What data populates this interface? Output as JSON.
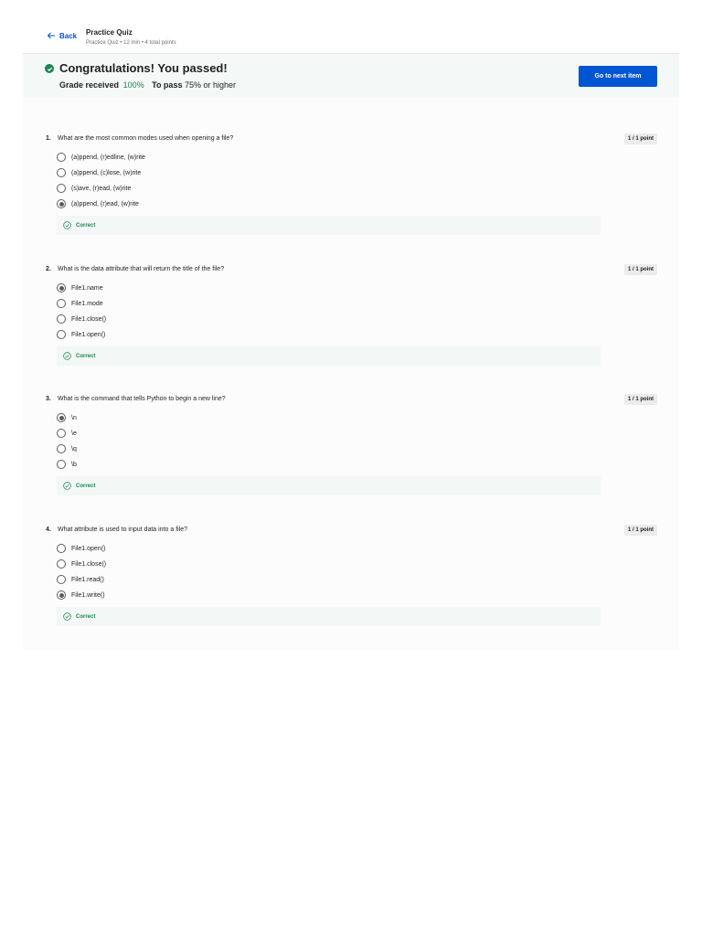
{
  "header": {
    "back_label": "Back",
    "title": "Practice Quiz",
    "subtitle": "Practice Quiz • 12 min • 4 total points"
  },
  "banner": {
    "message": "Congratulations! You passed!",
    "grade_label": "Grade received",
    "grade_value": "100%",
    "pass_label": "To pass",
    "pass_value": "75% or higher",
    "next_button": "Go to next item",
    "colors": {
      "success": "#1f8354",
      "primary": "#0056d2"
    }
  },
  "questions": [
    {
      "number": "1.",
      "text": "What are the most common modes used when opening a file?",
      "points": "1 / 1 point",
      "options": [
        "(a)ppend, (r)edline, (w)rite",
        "(a)ppend, (c)lose, (w)rite",
        "(s)ave, (r)ead, (w)rite",
        "(a)ppend, (r)ead, (w)rite"
      ],
      "selected_index": 3,
      "feedback": "Correct"
    },
    {
      "number": "2.",
      "text": "What is the data attribute that will return the title of the file?",
      "points": "1 / 1 point",
      "options": [
        "File1.name",
        "File1.mode",
        "File1.close()",
        "File1.open()"
      ],
      "selected_index": 0,
      "feedback": "Correct"
    },
    {
      "number": "3.",
      "text": "What is the command that tells Python to begin a new line?",
      "points": "1 / 1 point",
      "options": [
        "\\n",
        "\\e",
        "\\q",
        "\\b"
      ],
      "selected_index": 0,
      "feedback": "Correct"
    },
    {
      "number": "4.",
      "text": "What attribute is used to input data into a file?",
      "points": "1 / 1 point",
      "options": [
        "File1.open()",
        "File1.close()",
        "File1.read()",
        "File1.write()"
      ],
      "selected_index": 3,
      "feedback": "Correct"
    }
  ],
  "icons": {
    "back": "arrow-left-icon",
    "passed": "check-circle-filled-icon",
    "correct": "check-circle-outline-icon"
  }
}
